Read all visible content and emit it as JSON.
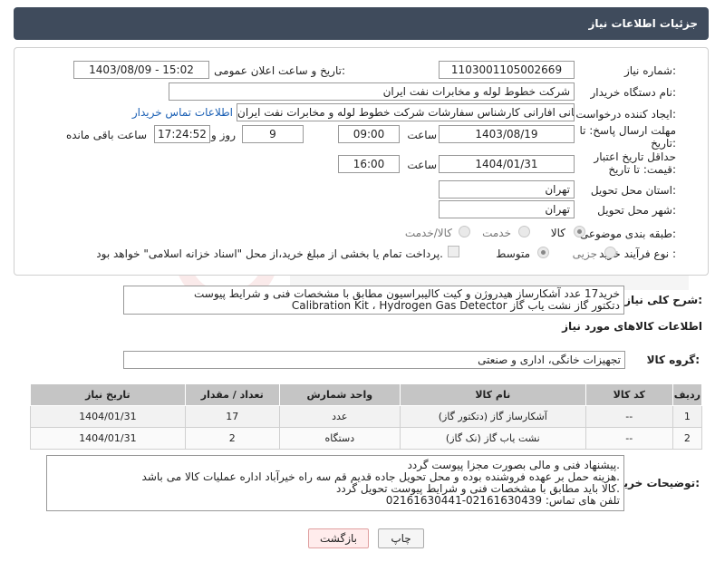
{
  "header": {
    "title": "جزئیات اطلاعات نیاز"
  },
  "fields": {
    "need_number_label": "شماره نیاز:",
    "need_number": "1103001105002669",
    "announce_label": "تاریخ و ساعت اعلان عمومی:",
    "announce_value": "1403/08/09 - 15:02",
    "buyer_org_label": "نام دستگاه خریدار:",
    "buyer_org": "شرکت خطوط لوله و مخابرات نفت ایران",
    "creator_label": "ایجاد کننده درخواست:",
    "creator": "مهدی سلطانی افارانی کارشناس سفارشات  شرکت خطوط لوله و مخابرات نفت ایران",
    "contact_link": "اطلاعات تماس خریدار",
    "deadline_label": "مهلت ارسال پاسخ: تا تاریخ:",
    "deadline_date": "1403/08/19",
    "time_word": "ساعت",
    "deadline_time": "09:00",
    "days_value": "9",
    "days_word": "روز و",
    "remaining_time": "17:24:52",
    "remaining_word": "ساعت باقی مانده",
    "validity_label": "حداقل تاریخ اعتبار قیمت: تا تاریخ:",
    "validity_date": "1404/01/31",
    "validity_time": "16:00",
    "province_label": "استان محل تحویل:",
    "province": "تهران",
    "city_label": "شهر محل تحویل:",
    "city": "تهران",
    "category_label": "طبقه بندی موضوعی:",
    "category_options": [
      "کالا",
      "خدمت",
      "کالا/خدمت"
    ],
    "process_label": "نوع فرآیند خرید :",
    "process_options": [
      "جزیی",
      "متوسط"
    ],
    "payment_note": "پرداخت تمام یا بخشی از مبلغ خرید،از محل \"اسناد خزانه اسلامی\" خواهد بود."
  },
  "summary": {
    "label": "شرح کلی نیاز:",
    "line1": "خرید17 عدد آشکارساز هیدروژن و کیت کالیبراسیون مطابق با  مشخصات فنی و شرایط پیوست",
    "line2": "Calibration Kit ، Hydrogen Gas Detector دتکتور گاز  نشت یاب گاز"
  },
  "goods_section": "اطلاعات کالاهای مورد نیاز",
  "goods_group_label": "گروه کالا:",
  "goods_group": "تجهیزات خانگی، اداری و صنعتی",
  "table": {
    "headers": [
      "ردیف",
      "کد کالا",
      "نام کالا",
      "واحد شمارش",
      "تعداد / مقدار",
      "تاریخ نیاز"
    ],
    "rows": [
      [
        "1",
        "--",
        "آشکارساز گاز (دتکتور گاز)",
        "عدد",
        "17",
        "1404/01/31"
      ],
      [
        "2",
        "--",
        "نشت یاب گاز (نک گاز)",
        "دستگاه",
        "2",
        "1404/01/31"
      ]
    ]
  },
  "buyer_notes": {
    "label": "توضیحات خریدار:",
    "lines": [
      "پیشنهاد فنی و مالی بصورت مجزا پیوست گردد.",
      "هزینه حمل بر عهده فروشنده بوده و محل تحویل جاده قدیم قم سه راه خیرآباد اداره عملیات کالا می باشد.",
      "کالا باید  مطابق با مشخصات فنی و شرایط پیوست تحویل گردد.",
      "تلفن های تماس: 02161630439-02161630441"
    ]
  },
  "buttons": {
    "print": "چاپ",
    "back": "بازگشت"
  }
}
